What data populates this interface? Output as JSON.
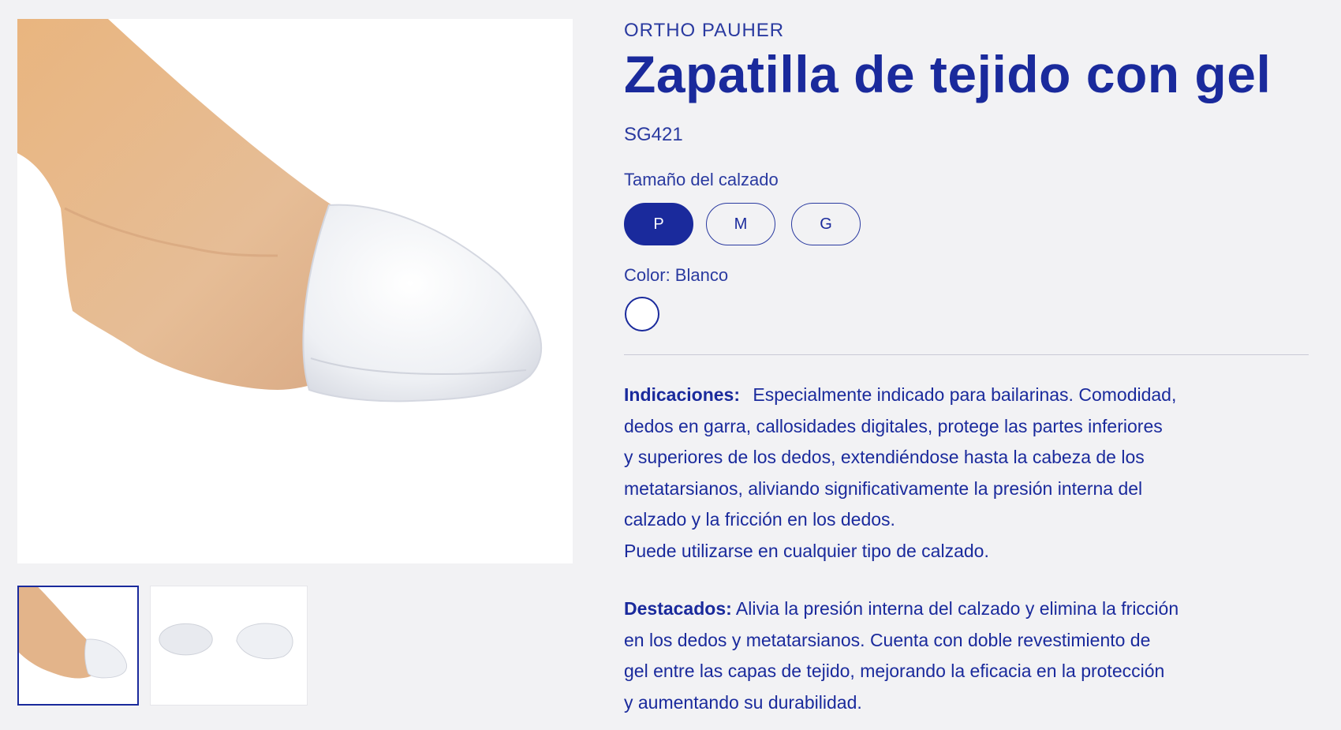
{
  "gallery": {
    "main_image_alt": "Foot wearing white fabric gel toe cap",
    "thumbnails": [
      {
        "alt": "Foot wearing toe cap",
        "selected": true
      },
      {
        "alt": "Pair of white toe caps",
        "selected": false
      }
    ]
  },
  "product": {
    "brand": "ORTHO PAUHER",
    "title": "Zapatilla de tejido con gel",
    "sku": "SG421",
    "size_label": "Tamaño del calzado",
    "sizes": [
      "P",
      "M",
      "G"
    ],
    "selected_size": "P",
    "color_label": "Color: Blanco",
    "color_swatch": "#ffffff"
  },
  "description": {
    "indications_label": "Indicaciones:",
    "indications_lines": [
      "Especialmente indicado para bailarinas. Comodidad,",
      "dedos en garra, callosidades digitales, protege las partes inferiores",
      "y superiores de los dedos, extendiéndose hasta la cabeza de los",
      "metatarsianos, aliviando significativamente la presión interna del",
      "calzado y la fricción en los dedos.",
      "Puede utilizarse en cualquier tipo de calzado."
    ],
    "highlights_label": "Destacados:",
    "highlights_lines": [
      "Alivia la presión interna del calzado y elimina la fricción",
      "en los dedos y metatarsianos. Cuenta con doble revestimiento de",
      "gel entre las capas de tejido, mejorando la eficacia en la protección",
      "y aumentando su durabilidad."
    ]
  },
  "colors": {
    "accent": "#1a2a9c",
    "background": "#f2f2f4",
    "skin": "#e3b48a"
  }
}
